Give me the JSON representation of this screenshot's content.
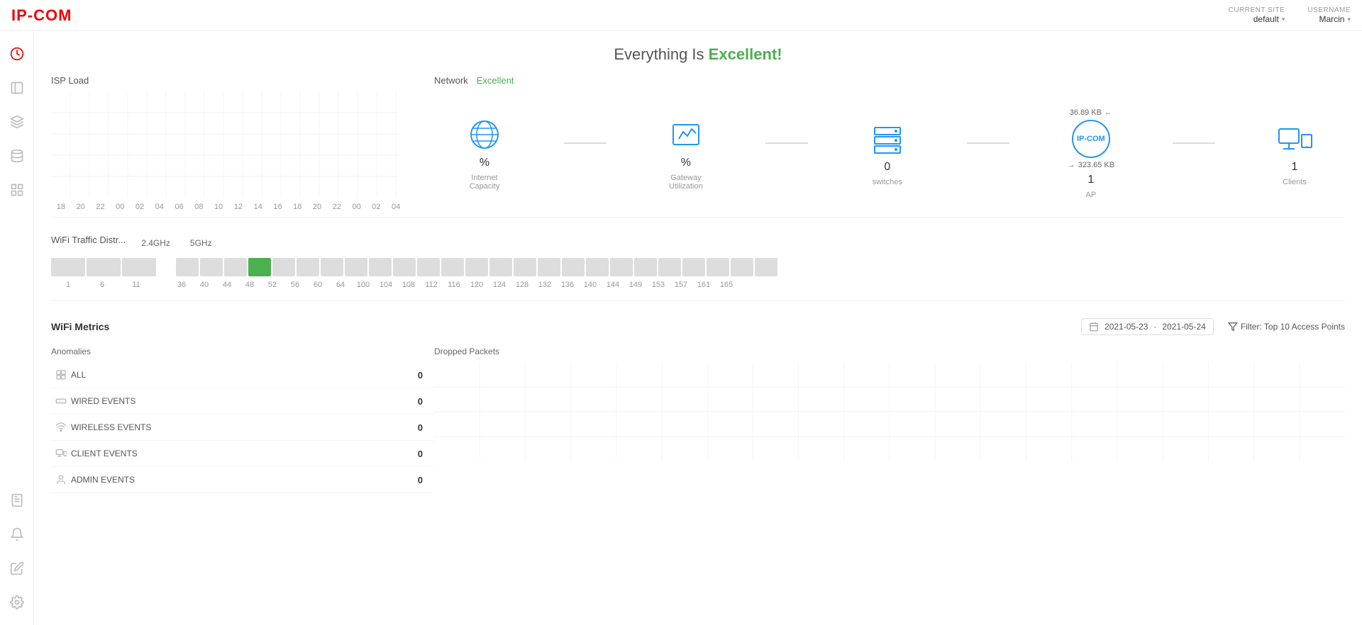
{
  "header": {
    "logo": "IP-COM",
    "current_site_label": "CURRENT SITE",
    "current_site_value": "default",
    "username_label": "USERNAME",
    "username_value": "Marcin"
  },
  "sidebar": {
    "items": [
      {
        "id": "dashboard",
        "icon": "cloud",
        "active": true
      },
      {
        "id": "list",
        "icon": "list"
      },
      {
        "id": "layers",
        "icon": "layers"
      },
      {
        "id": "database",
        "icon": "database"
      },
      {
        "id": "grid",
        "icon": "grid"
      }
    ],
    "bottom_items": [
      {
        "id": "report",
        "icon": "report"
      },
      {
        "id": "bell",
        "icon": "bell"
      },
      {
        "id": "edit",
        "icon": "edit"
      },
      {
        "id": "settings",
        "icon": "settings"
      }
    ]
  },
  "main": {
    "headline": "Everything Is",
    "headline_accent": "Excellent!",
    "isp_load_title": "ISP Load",
    "network_label": "Network",
    "network_status": "Excellent",
    "x_axis_labels": [
      "18",
      "20",
      "22",
      "00",
      "02",
      "04",
      "06",
      "08",
      "10",
      "12",
      "14",
      "16",
      "18",
      "20",
      "22",
      "00",
      "02",
      "04"
    ],
    "network_items": [
      {
        "id": "internet",
        "label_line1": "Internet",
        "label_line2": "Capacity",
        "value": "%"
      },
      {
        "id": "gateway",
        "label_line1": "Gateway",
        "label_line2": "Utilization",
        "value": "%"
      },
      {
        "id": "switches",
        "label_line1": "Switches",
        "label_line2": "",
        "value": "0"
      },
      {
        "id": "ap",
        "label_line1": "AP",
        "label_line2": "",
        "value": "1",
        "traffic_in": "36.89 KB",
        "traffic_out": "323.65 KB"
      },
      {
        "id": "clients",
        "label_line1": "Clients",
        "label_line2": "",
        "value": "1"
      }
    ],
    "wifi_traffic_title": "WiFi Traffic Distr...",
    "tabs": [
      {
        "id": "2.4ghz",
        "label": "2.4GHz",
        "active": false
      },
      {
        "id": "5ghz",
        "label": "5GHz",
        "active": false
      }
    ],
    "channel_labels": [
      "1",
      "6",
      "11",
      "36",
      "40",
      "44",
      "48",
      "52",
      "56",
      "60",
      "64",
      "100",
      "104",
      "108",
      "112",
      "116",
      "120",
      "124",
      "128",
      "132",
      "136",
      "140",
      "144",
      "149",
      "153",
      "157",
      "161",
      "165"
    ],
    "wifi_metrics": {
      "title": "WiFi Metrics",
      "date_from": "2021-05-23",
      "date_to": "2021-05-24",
      "filter_label": "Filter: Top 10 Access Points"
    },
    "anomalies_title": "Anomalies",
    "dropped_packets_title": "Dropped Packets",
    "anomaly_rows": [
      {
        "id": "all",
        "label": "ALL",
        "count": "0"
      },
      {
        "id": "wired",
        "label": "WIRED EVENTS",
        "count": "0"
      },
      {
        "id": "wireless",
        "label": "WIRELESS EVENTS",
        "count": "0"
      },
      {
        "id": "client",
        "label": "CLIENT EVENTS",
        "count": "0"
      },
      {
        "id": "admin",
        "label": "ADMIN EVENTS",
        "count": "0"
      }
    ]
  }
}
